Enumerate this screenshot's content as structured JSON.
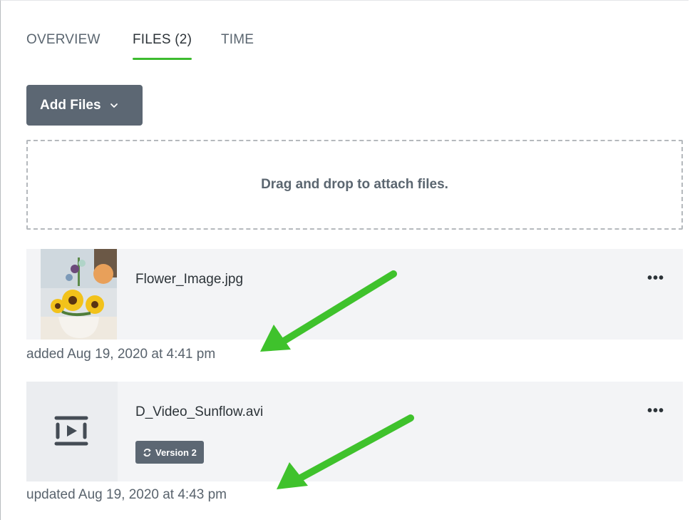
{
  "tabs": [
    {
      "label": "OVERVIEW",
      "active": false
    },
    {
      "label": "FILES (2)",
      "active": true
    },
    {
      "label": "TIME",
      "active": false
    }
  ],
  "toolbar": {
    "add_files_label": "Add Files"
  },
  "dropzone": {
    "text": "Drag and drop to attach files."
  },
  "files": [
    {
      "name": "Flower_Image.jpg",
      "meta": "added Aug 19, 2020 at 4:41 pm",
      "more": "•••"
    },
    {
      "name": "D_Video_Sunflow.avi",
      "badge": "Version 2",
      "meta": "updated Aug 19, 2020 at 4:43 pm",
      "more": "•••"
    }
  ],
  "colors": {
    "accent": "#3dbb2f",
    "button": "#5c6773",
    "card": "#f3f4f6",
    "annotation": "#3fc22c"
  }
}
